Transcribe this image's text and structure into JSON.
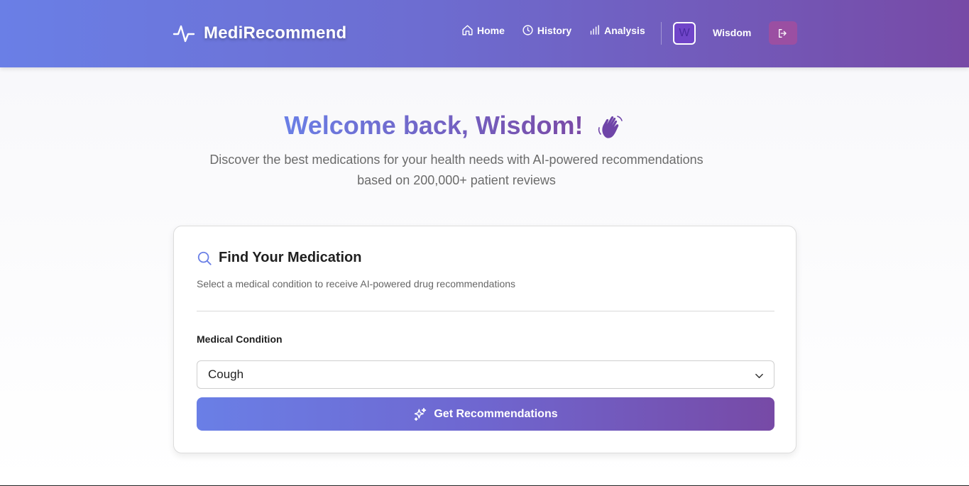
{
  "header": {
    "brand": "MediRecommend",
    "nav": [
      {
        "label": "Home",
        "icon": "home-icon"
      },
      {
        "label": "History",
        "icon": "clock-icon"
      },
      {
        "label": "Analysis",
        "icon": "bar-chart-icon"
      }
    ],
    "avatar_initial": "W",
    "username": "Wisdom",
    "logout_icon": "logout-icon"
  },
  "hero": {
    "title": "Welcome back, Wisdom!",
    "emoji_icon": "waving-hand-icon",
    "subtitle_line1": "Discover the best medications for your health needs with AI-powered recommendations",
    "subtitle_line2": "based on 200,000+ patient reviews"
  },
  "card": {
    "title": "Find Your Medication",
    "description": "Select a medical condition to receive AI-powered drug recommendations",
    "field_label": "Medical Condition",
    "selected_condition": "Cough",
    "button_label": "Get Recommendations"
  },
  "colors": {
    "gradient_start": "#6a7fe6",
    "gradient_end": "#774aa6",
    "logout_bg": "#9b4fa2"
  }
}
